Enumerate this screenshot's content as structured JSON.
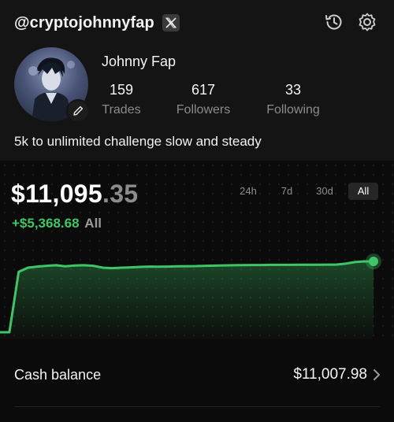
{
  "profile": {
    "handle": "@cryptojohnnyfap",
    "display_name": "Johnny Fap",
    "bio": "5k to unlimited challenge slow and steady",
    "stats": [
      {
        "value": "159",
        "label": "Trades"
      },
      {
        "value": "617",
        "label": "Followers"
      },
      {
        "value": "33",
        "label": "Following"
      }
    ]
  },
  "icons": {
    "x_badge": "x-logo-icon",
    "history": "history-icon",
    "settings": "gear-icon",
    "edit": "pencil-icon",
    "chevron": "chevron-right-icon"
  },
  "portfolio": {
    "balance_main": "$11,095",
    "balance_cents": ".35",
    "pnl_value": "+$5,368.68",
    "pnl_range": "All",
    "ranges": [
      "24h",
      "7d",
      "30d",
      "All"
    ],
    "active_range": "All"
  },
  "chart_data": {
    "type": "area",
    "title": "",
    "xlabel": "",
    "ylabel": "",
    "x": [
      0,
      1,
      2,
      3,
      4,
      5,
      6,
      7,
      8,
      9,
      10,
      11,
      12,
      13,
      14,
      15,
      16,
      17,
      18,
      19,
      20,
      21,
      22,
      23,
      24,
      25,
      26,
      27,
      28,
      29,
      30,
      31,
      32,
      33,
      34,
      35,
      36,
      37,
      38,
      39,
      40
    ],
    "values": [
      5727,
      5727,
      10300,
      10620,
      10700,
      10760,
      10800,
      10720,
      10780,
      10800,
      10760,
      10620,
      10580,
      10620,
      10640,
      10680,
      10700,
      10690,
      10700,
      10720,
      10730,
      10740,
      10760,
      10770,
      10790,
      10800,
      10810,
      10820,
      10820,
      10830,
      10830,
      10830,
      10840,
      10840,
      10840,
      10850,
      10850,
      10920,
      11040,
      11095,
      11095
    ],
    "color": "#3fc566"
  },
  "cash": {
    "label": "Cash balance",
    "value": "$11,007.98"
  },
  "colors": {
    "background": "#0b0b0b",
    "panel": "#141414",
    "accent_green": "#3fc566",
    "muted": "#8b8b8b"
  }
}
